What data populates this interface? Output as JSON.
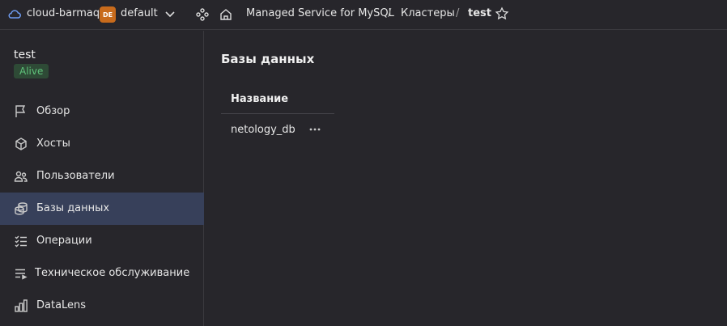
{
  "header": {
    "cloud_name": "cloud-barmaq",
    "folder_badge": "DE",
    "folder_name": "default",
    "breadcrumbs": [
      "Managed Service for MySQL",
      "Кластеры",
      "test"
    ],
    "separator": "/"
  },
  "sidebar": {
    "cluster_name": "test",
    "status": "Alive",
    "items": [
      {
        "label": "Обзор",
        "icon": "flag-icon"
      },
      {
        "label": "Хосты",
        "icon": "cube-icon"
      },
      {
        "label": "Пользователи",
        "icon": "users-icon"
      },
      {
        "label": "Базы данных",
        "icon": "databases-icon",
        "active": true
      },
      {
        "label": "Операции",
        "icon": "checklist-icon"
      },
      {
        "label": "Техническое обслуживание",
        "icon": "maintenance-icon"
      },
      {
        "label": "DataLens",
        "icon": "chart-icon"
      }
    ]
  },
  "main": {
    "title": "Базы данных",
    "table": {
      "columns": [
        "Название"
      ],
      "rows": [
        [
          "netology_db"
        ]
      ]
    }
  },
  "colors": {
    "background": "#27262b",
    "active_nav": "#37405a",
    "folder_badge": "#c86b1c",
    "status_bg": "#2e4a36",
    "status_text": "#5fc27a"
  }
}
